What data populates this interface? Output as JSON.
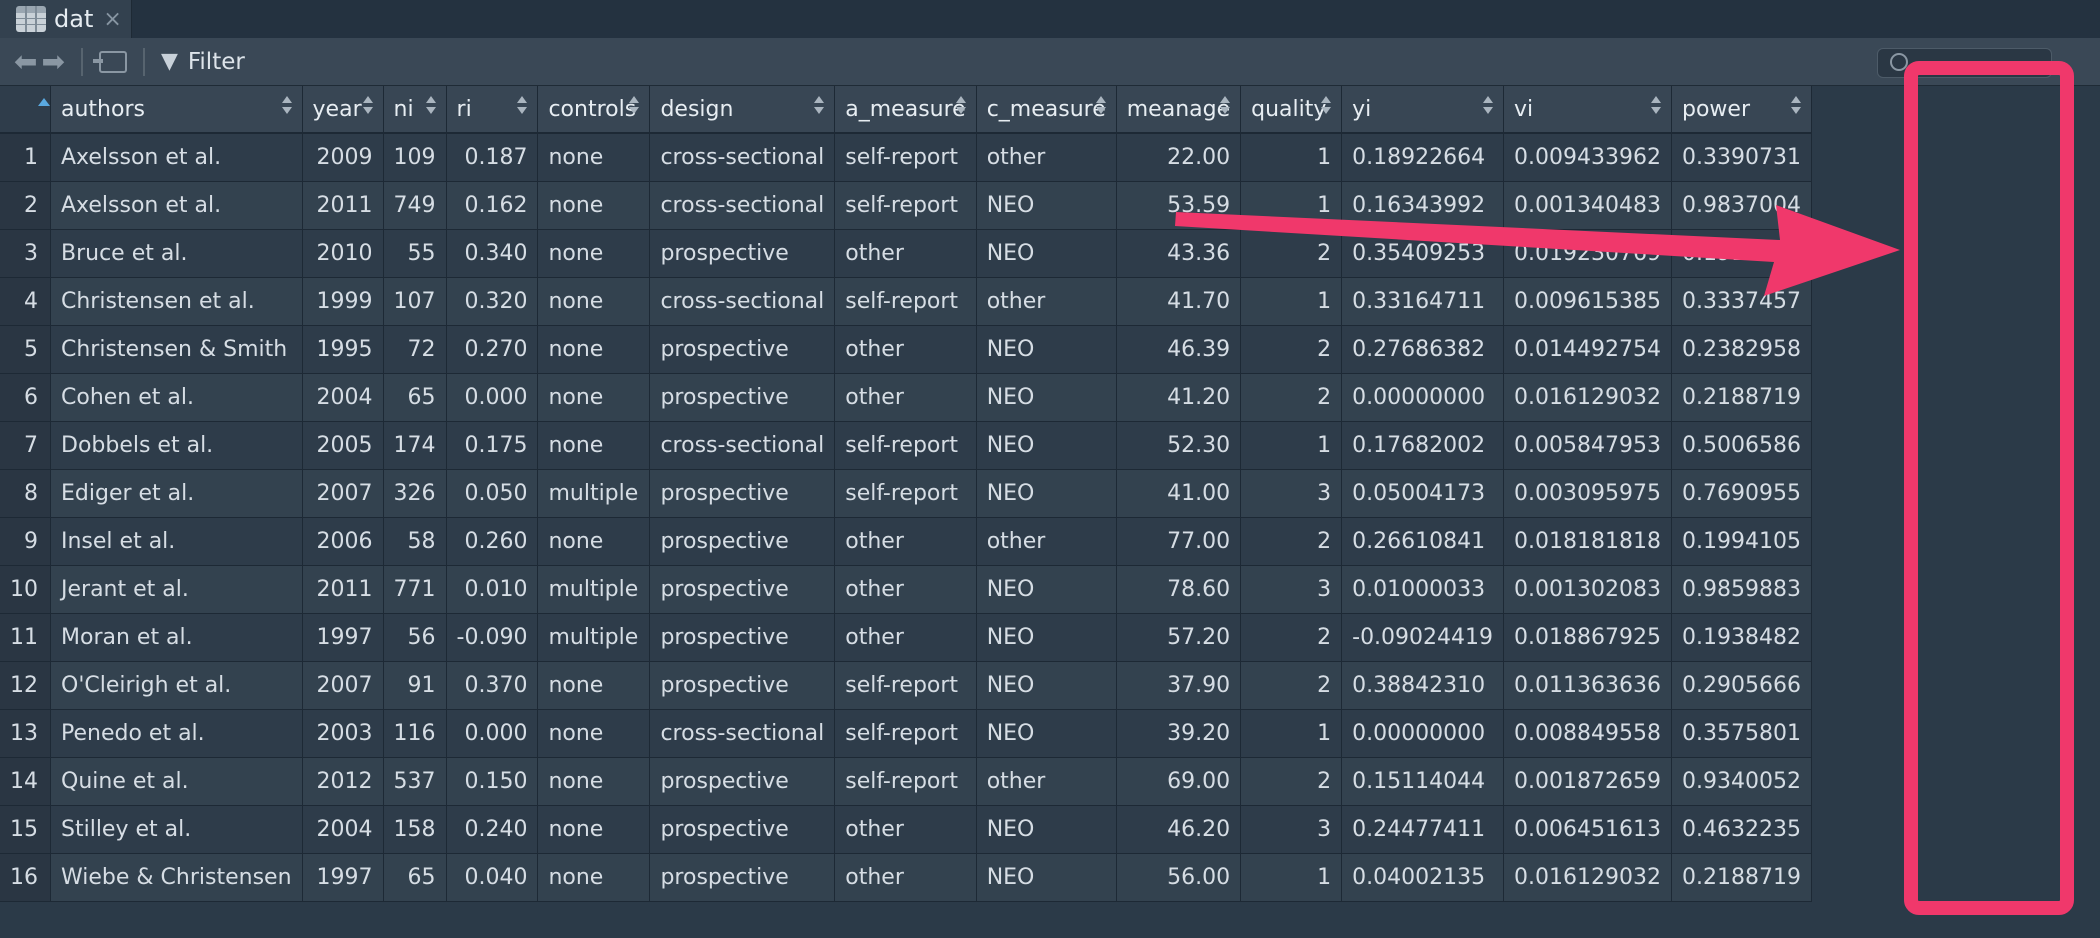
{
  "tab": {
    "title": "dat",
    "close": "×"
  },
  "toolbar": {
    "filter_label": "Filter"
  },
  "table": {
    "columns": [
      {
        "key": "authors",
        "label": "authors",
        "align": "left"
      },
      {
        "key": "year",
        "label": "year",
        "align": "right"
      },
      {
        "key": "ni",
        "label": "ni",
        "align": "right"
      },
      {
        "key": "ri",
        "label": "ri",
        "align": "right"
      },
      {
        "key": "controls",
        "label": "controls",
        "align": "left"
      },
      {
        "key": "design",
        "label": "design",
        "align": "left"
      },
      {
        "key": "a_measure",
        "label": "a_measure",
        "align": "left"
      },
      {
        "key": "c_measure",
        "label": "c_measure",
        "align": "left"
      },
      {
        "key": "meanage",
        "label": "meanage",
        "align": "right"
      },
      {
        "key": "quality",
        "label": "quality",
        "align": "right"
      },
      {
        "key": "yi",
        "label": "yi",
        "align": "left"
      },
      {
        "key": "vi",
        "label": "vi",
        "align": "left"
      },
      {
        "key": "power",
        "label": "power",
        "align": "left"
      }
    ],
    "rows": [
      [
        "1",
        "Axelsson et al.",
        "2009",
        "109",
        "0.187",
        "none",
        "cross-sectional",
        "self-report",
        "other",
        "22.00",
        "1",
        "0.18922664",
        "0.009433962",
        "0.3390731"
      ],
      [
        "2",
        "Axelsson et al.",
        "2011",
        "749",
        "0.162",
        "none",
        "cross-sectional",
        "self-report",
        "NEO",
        "53.59",
        "1",
        "0.16343992",
        "0.001340483",
        "0.9837004"
      ],
      [
        "3",
        "Bruce et al.",
        "2010",
        "55",
        "0.340",
        "none",
        "prospective",
        "other",
        "NEO",
        "43.36",
        "2",
        "0.35409253",
        "0.019230769",
        "0.1910674"
      ],
      [
        "4",
        "Christensen et al.",
        "1999",
        "107",
        "0.320",
        "none",
        "cross-sectional",
        "self-report",
        "other",
        "41.70",
        "1",
        "0.33164711",
        "0.009615385",
        "0.3337457"
      ],
      [
        "5",
        "Christensen & Smith",
        "1995",
        "72",
        "0.270",
        "none",
        "prospective",
        "other",
        "NEO",
        "46.39",
        "2",
        "0.27686382",
        "0.014492754",
        "0.2382958"
      ],
      [
        "6",
        "Cohen et al.",
        "2004",
        "65",
        "0.000",
        "none",
        "prospective",
        "other",
        "NEO",
        "41.20",
        "2",
        "0.00000000",
        "0.016129032",
        "0.2188719"
      ],
      [
        "7",
        "Dobbels et al.",
        "2005",
        "174",
        "0.175",
        "none",
        "cross-sectional",
        "self-report",
        "NEO",
        "52.30",
        "1",
        "0.17682002",
        "0.005847953",
        "0.5006586"
      ],
      [
        "8",
        "Ediger et al.",
        "2007",
        "326",
        "0.050",
        "multiple",
        "prospective",
        "self-report",
        "NEO",
        "41.00",
        "3",
        "0.05004173",
        "0.003095975",
        "0.7690955"
      ],
      [
        "9",
        "Insel et al.",
        "2006",
        "58",
        "0.260",
        "none",
        "prospective",
        "other",
        "other",
        "77.00",
        "2",
        "0.26610841",
        "0.018181818",
        "0.1994105"
      ],
      [
        "10",
        "Jerant et al.",
        "2011",
        "771",
        "0.010",
        "multiple",
        "prospective",
        "other",
        "NEO",
        "78.60",
        "3",
        "0.01000033",
        "0.001302083",
        "0.9859883"
      ],
      [
        "11",
        "Moran et al.",
        "1997",
        "56",
        "-0.090",
        "multiple",
        "prospective",
        "other",
        "NEO",
        "57.20",
        "2",
        "-0.09024419",
        "0.018867925",
        "0.1938482"
      ],
      [
        "12",
        "O'Cleirigh et al.",
        "2007",
        "91",
        "0.370",
        "none",
        "prospective",
        "self-report",
        "NEO",
        "37.90",
        "2",
        "0.38842310",
        "0.011363636",
        "0.2905666"
      ],
      [
        "13",
        "Penedo et al.",
        "2003",
        "116",
        "0.000",
        "none",
        "cross-sectional",
        "self-report",
        "NEO",
        "39.20",
        "1",
        "0.00000000",
        "0.008849558",
        "0.3575801"
      ],
      [
        "14",
        "Quine et al.",
        "2012",
        "537",
        "0.150",
        "none",
        "prospective",
        "self-report",
        "other",
        "69.00",
        "2",
        "0.15114044",
        "0.001872659",
        "0.9340052"
      ],
      [
        "15",
        "Stilley et al.",
        "2004",
        "158",
        "0.240",
        "none",
        "prospective",
        "other",
        "NEO",
        "46.20",
        "3",
        "0.24477411",
        "0.006451613",
        "0.4632235"
      ],
      [
        "16",
        "Wiebe & Christensen",
        "1997",
        "65",
        "0.040",
        "none",
        "prospective",
        "other",
        "NEO",
        "56.00",
        "1",
        "0.04002135",
        "0.016129032",
        "0.2188719"
      ]
    ]
  },
  "annotation": {
    "highlight_color": "#f0386b",
    "highlighted_column": "power"
  }
}
